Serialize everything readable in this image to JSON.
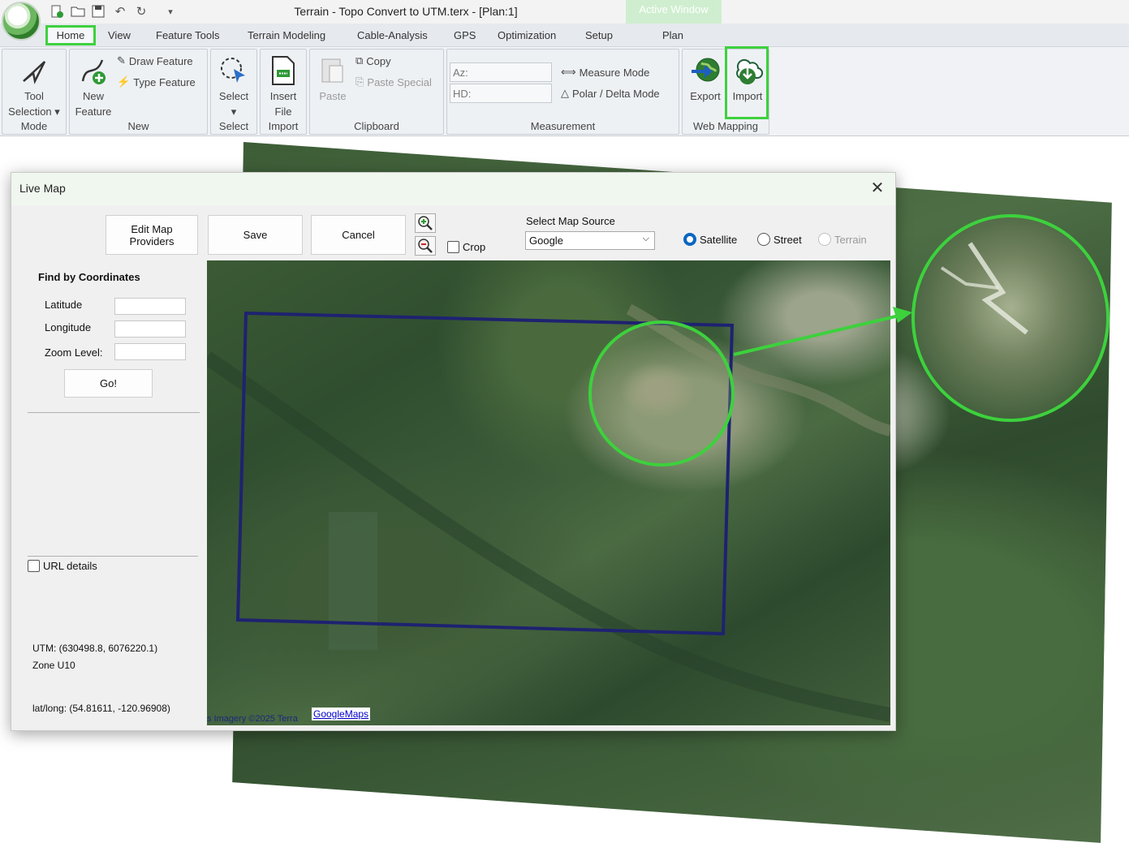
{
  "window": {
    "title": "Terrain - Topo Convert to UTM.terx - [Plan:1]",
    "active_window_label": "Active Window"
  },
  "tabs": [
    "Home",
    "View",
    "Feature Tools",
    "Terrain Modeling",
    "Cable-Analysis",
    "GPS",
    "Optimization",
    "Setup",
    "Plan"
  ],
  "ribbon": {
    "mode": {
      "label": "Mode",
      "tool_selection": "Tool",
      "tool_selection_2": "Selection"
    },
    "new": {
      "label": "New",
      "new_feature": "New",
      "new_feature_2": "Feature",
      "draw_feature": "Draw Feature",
      "type_feature": "Type Feature"
    },
    "select": {
      "label": "Select",
      "select_btn": "Select"
    },
    "import": {
      "label": "Import",
      "insert_file": "Insert",
      "insert_file_2": "File"
    },
    "clipboard": {
      "label": "Clipboard",
      "paste": "Paste",
      "copy": "Copy",
      "paste_special": "Paste Special"
    },
    "measurement": {
      "label": "Measurement",
      "az": "Az:",
      "hd": "HD:",
      "measure_mode": "Measure Mode",
      "polar_delta": "Polar / Delta Mode"
    },
    "web_mapping": {
      "label": "Web Mapping",
      "export": "Export",
      "import": "Import"
    }
  },
  "dialog": {
    "title": "Live Map",
    "edit_map_providers": "Edit Map",
    "edit_map_providers_2": "Providers",
    "save": "Save",
    "cancel": "Cancel",
    "crop": "Crop",
    "select_map_source_label": "Select Map Source",
    "map_source": "Google",
    "radio": {
      "satellite": "Satellite",
      "street": "Street",
      "terrain": "Terrain"
    },
    "find_by_coords": "Find by Coordinates",
    "latitude": "Latitude",
    "longitude": "Longitude",
    "zoom_level": "Zoom Level:",
    "go": "Go!",
    "url_details": "URL details",
    "utm": "UTM: (630498.8, 6076220.1)",
    "zone": "Zone U10",
    "latlong": "lat/long: (54.81611, -120.96908)",
    "map_attribution": "s Imagery ©2025 Terra",
    "map_link": "GoogleMaps"
  },
  "colors": {
    "highlight": "#3dd13d",
    "selection_rect": "#1e2270",
    "radio_selected": "#0a66c2"
  }
}
